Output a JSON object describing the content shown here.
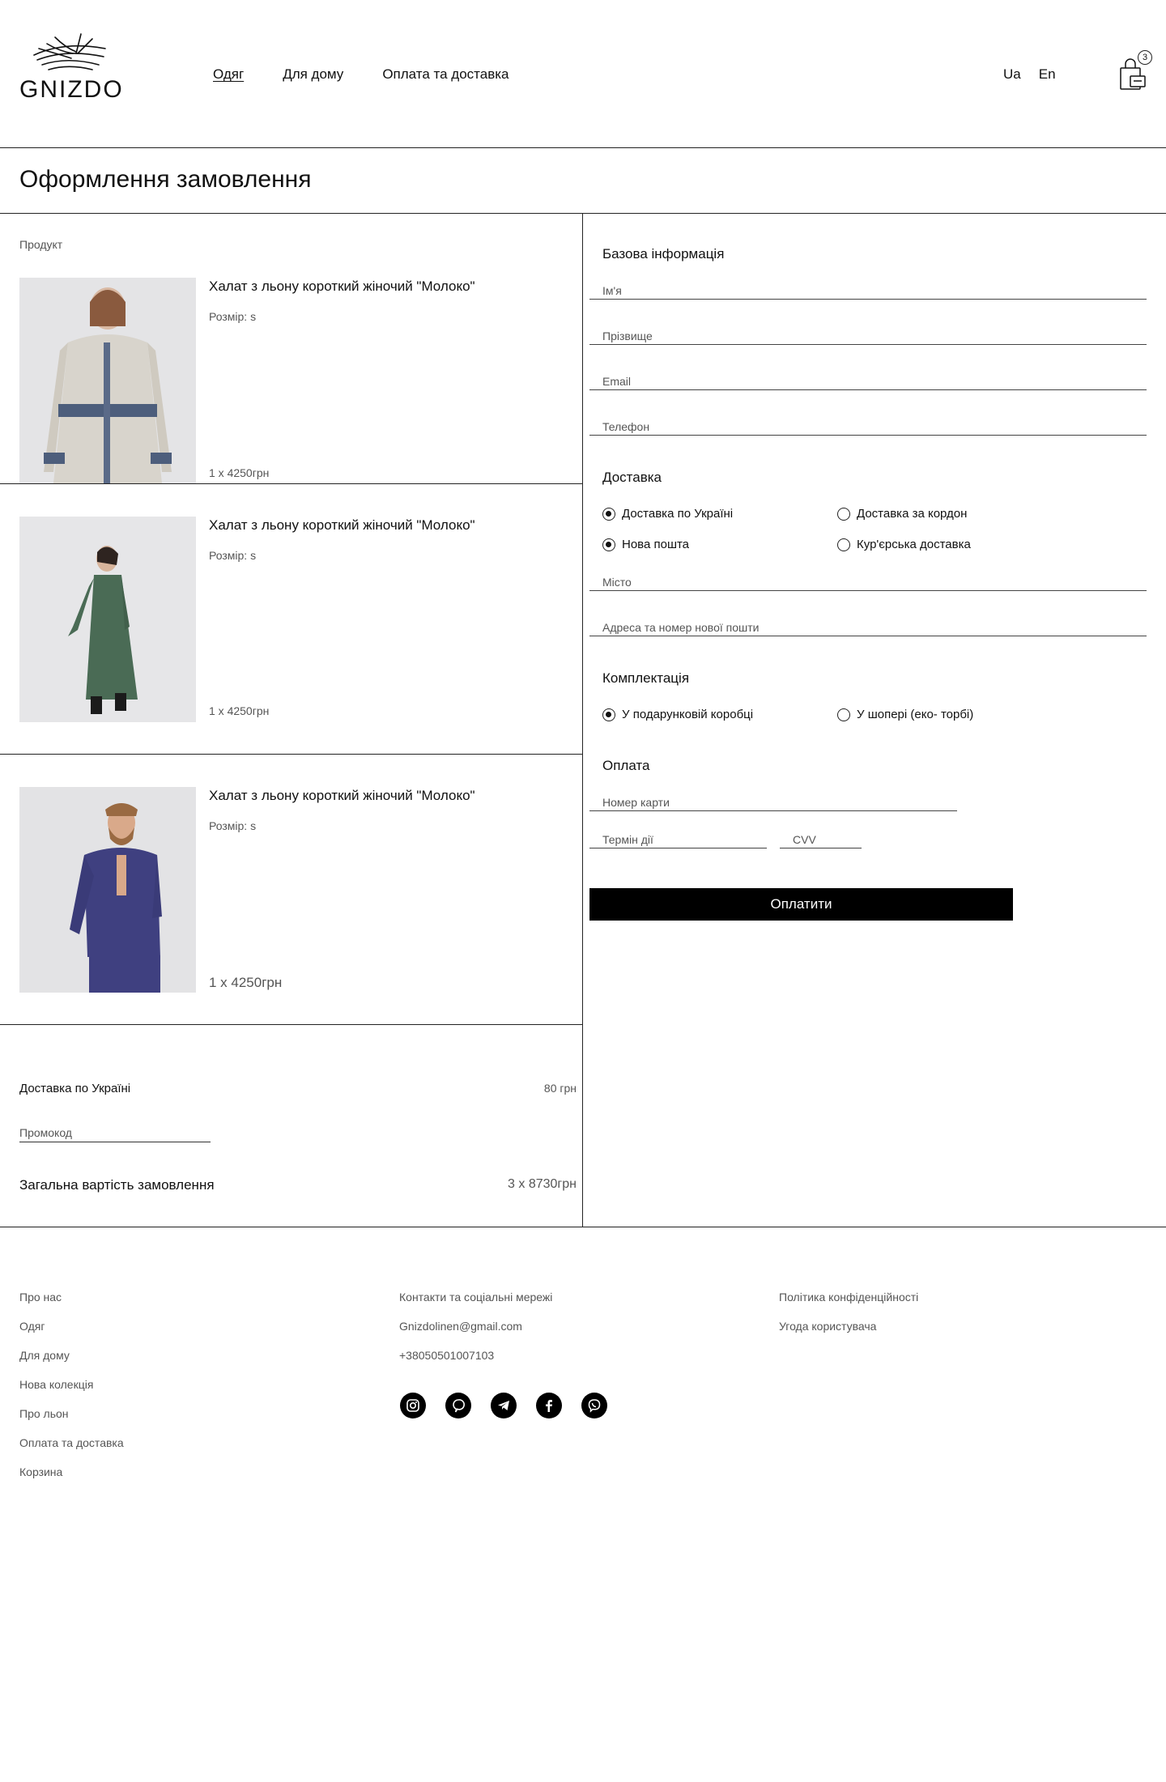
{
  "brand": {
    "name": "GNIZDO"
  },
  "nav": {
    "items": [
      "Одяг",
      "Для дому",
      "Оплата та доставка"
    ],
    "active": "Одяг"
  },
  "lang": {
    "ua": "Ua",
    "en": "En"
  },
  "cart": {
    "count": "3"
  },
  "page": {
    "title": "Оформлення замовлення"
  },
  "order": {
    "column_label": "Продукт",
    "products": [
      {
        "name": "Халат з льону короткий жіночий \"Молоко\"",
        "size": "Розмір: s",
        "qty": "1 x 4250грн",
        "garment": "striped-jacket"
      },
      {
        "name": "Халат з льону короткий жіночий \"Молоко\"",
        "size": "Розмір: s",
        "qty": "1 x 4250грн",
        "garment": "green-coat"
      },
      {
        "name": "Халат з льону короткий жіночий \"Молоко\"",
        "size": "Розмір: s",
        "qty": "1 x 4250грн",
        "garment": "blue-shirt"
      }
    ],
    "shipping_label": "Доставка по Україні",
    "shipping_price": "80 грн",
    "promo_placeholder": "Промокод",
    "total_label": "Загальна вартість замовлення",
    "total_price": "3 x 8730грн"
  },
  "form": {
    "basic_title": "Базова інформація",
    "fields": {
      "first_name": "Ім'я",
      "last_name": "Прізвище",
      "email": "Email",
      "phone": "Телефон"
    },
    "delivery_title": "Доставка",
    "delivery_options": {
      "ukraine": "Доставка по Україні",
      "abroad": "Доставка за кордон",
      "nova_poshta": "Нова пошта",
      "courier": "Кур'єрська доставка"
    },
    "city": "Місто",
    "address": "Адреса та номер нової пошти",
    "packaging_title": "Комплектація",
    "packaging_options": {
      "gift_box": "У подарунковій коробці",
      "eco_bag": "У шопері (еко- торбі)"
    },
    "payment_title": "Оплата",
    "card_number": "Номер карти",
    "expiry": "Термін дії",
    "cvv": "CVV",
    "pay_button": "Оплатити"
  },
  "footer": {
    "col1": [
      "Про нас",
      "Одяг",
      "Для дому",
      "Нова колекція",
      "Про льон",
      "Оплата та доставка",
      "Корзина"
    ],
    "col2": [
      "Контакти та соціальні мережі",
      "Gnizdolinen@gmail.com",
      "+38050501007103"
    ],
    "col3": [
      "Політика конфіденційності",
      "Угода користувача"
    ],
    "socials": [
      "instagram-icon",
      "pinterest-icon",
      "telegram-icon",
      "facebook-icon",
      "viber-icon"
    ]
  }
}
